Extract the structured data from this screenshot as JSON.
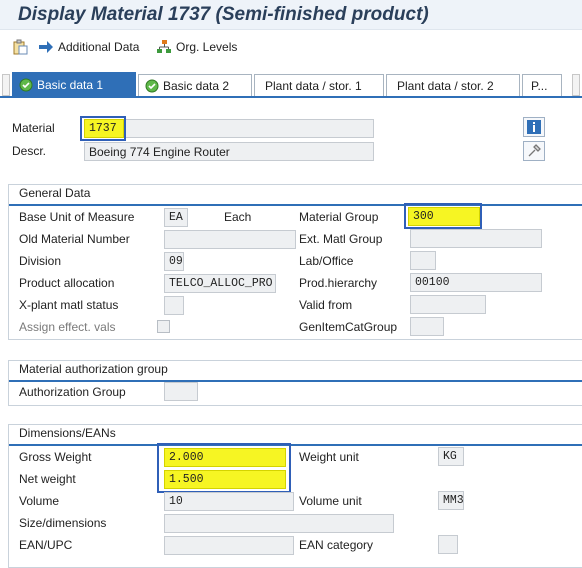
{
  "window": {
    "title": "Display Material 1737 (Semi-finished product)"
  },
  "toolbar": {
    "additional_data_label": "Additional Data",
    "org_levels_label": "Org. Levels"
  },
  "tabs": [
    {
      "label": "Basic data 1",
      "active": true
    },
    {
      "label": "Basic data 2",
      "active": false
    },
    {
      "label": "Plant data / stor. 1",
      "active": false
    },
    {
      "label": "Plant data / stor. 2",
      "active": false
    },
    {
      "label": "P...",
      "active": false
    }
  ],
  "header": {
    "material_label": "Material",
    "material_value": "1737",
    "descr_label": "Descr.",
    "descr_value": "Boeing 774 Engine Router"
  },
  "general_data": {
    "title": "General Data",
    "base_unit_label": "Base Unit of Measure",
    "base_unit_value": "EA",
    "base_unit_text": "Each",
    "material_group_label": "Material Group",
    "material_group_value": "300",
    "old_material_label": "Old Material Number",
    "old_material_value": "",
    "ext_matl_group_label": "Ext. Matl Group",
    "ext_matl_group_value": "",
    "division_label": "Division",
    "division_value": "09",
    "lab_office_label": "Lab/Office",
    "lab_office_value": "",
    "product_alloc_label": "Product allocation",
    "product_alloc_value": "TELCO_ALLOC_PRO",
    "prod_hierarchy_label": "Prod.hierarchy",
    "prod_hierarchy_value": "00100",
    "xplant_status_label": "X-plant matl status",
    "xplant_status_value": "",
    "valid_from_label": "Valid from",
    "valid_from_value": "",
    "assign_effect_label": "Assign effect. vals",
    "gen_item_cat_label": "GenItemCatGroup",
    "gen_item_cat_value": ""
  },
  "auth_group": {
    "title": "Material authorization group",
    "authorization_label": "Authorization Group",
    "authorization_value": ""
  },
  "dimensions": {
    "title": "Dimensions/EANs",
    "gross_weight_label": "Gross Weight",
    "gross_weight_value": "2.000",
    "weight_unit_label": "Weight unit",
    "weight_unit_value": "KG",
    "net_weight_label": "Net weight",
    "net_weight_value": "1.500",
    "volume_label": "Volume",
    "volume_value": "10",
    "volume_unit_label": "Volume unit",
    "volume_unit_value": "MM3",
    "size_label": "Size/dimensions",
    "size_value": "",
    "ean_label": "EAN/UPC",
    "ean_value": "",
    "ean_category_label": "EAN category",
    "ean_category_value": ""
  },
  "colors": {
    "highlight": "#f6f523",
    "highlight_border": "#2f5fb7",
    "accent": "#2f6fb7"
  }
}
